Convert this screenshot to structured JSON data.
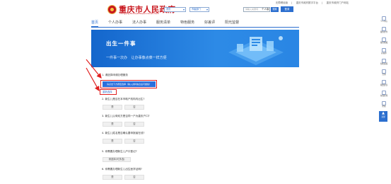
{
  "top_links": [
    "无障碍阅读",
    "重庆市政府数字平台",
    "重庆市政府门户网站"
  ],
  "site": {
    "title": "重庆市人民政府",
    "subtitle": "Chongqing Municipal People's Government"
  },
  "header": {
    "region_select": "重庆",
    "dept_select": "市级部门",
    "search_placeholder": "请输入关键词",
    "search_button": "搜索",
    "personal_label": "个人版",
    "login_label": "登录"
  },
  "nav": {
    "tabs": [
      "首页",
      "个人办事",
      "法人办事",
      "服务清单",
      "特色服务",
      "好差评",
      "阳光监督"
    ],
    "active": 0
  },
  "banner": {
    "title": "出生一件事",
    "sub1": "一件事一次办",
    "sub2": "让办事像点菜一样方便"
  },
  "questions": {
    "q1": "1. 请选择申请办理服务",
    "q1_option": "请点击下方按钮选择（输入资料信息后可继续）",
    "restart": "重新选择",
    "q2": "2. 新生儿是否在本市助产机构内出生?",
    "q3": "3. 新生儿父母双方是否同一户为重庆户口?",
    "q4": "4. 新生儿姓名是否确认要申报者在线?",
    "q5": "5. 你需要办理新生儿户口登记?",
    "q5_option": "请选择(可多选)",
    "q6": "6. 你需要办理新生儿出生医学证明?",
    "yes": "是",
    "no": "否"
  },
  "right_sidebar": {
    "items": [
      "个人中心",
      "我的办件",
      "我的收藏",
      "好差评",
      "智能客服",
      "咨询",
      "我要建议",
      "在线办理",
      "帮助"
    ],
    "top_label": "顶部"
  },
  "colors": {
    "brand_red": "#c8161d",
    "accent_blue": "#2c6fcf",
    "highlight_red": "#e02020"
  }
}
